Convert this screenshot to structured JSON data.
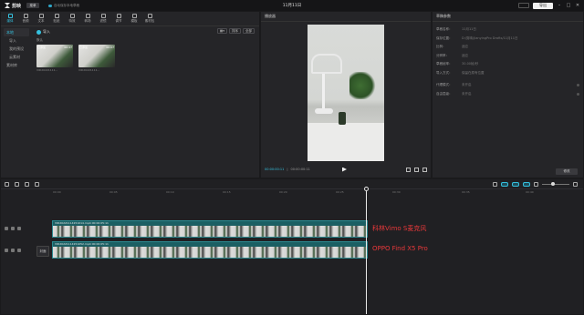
{
  "titlebar": {
    "app_name": "剪映",
    "menu_label": "菜单",
    "autosave_text": "自动保存本地草稿",
    "doc_title": "11月11日",
    "export_label": "导出"
  },
  "toolbar": {
    "items": [
      {
        "label": "媒体"
      },
      {
        "label": "音频"
      },
      {
        "label": "文本"
      },
      {
        "label": "贴纸"
      },
      {
        "label": "特效"
      },
      {
        "label": "转场"
      },
      {
        "label": "滤镜"
      },
      {
        "label": "调节"
      },
      {
        "label": "模板"
      },
      {
        "label": "素材包"
      }
    ]
  },
  "side_nav": {
    "items": [
      {
        "label": "本地"
      },
      {
        "label": "导入"
      },
      {
        "label": "我的预设"
      },
      {
        "label": "云素材"
      },
      {
        "label": "素材库"
      }
    ]
  },
  "media": {
    "import_label": "导入",
    "tools": [
      "排序",
      "全部"
    ],
    "section_label": "默认",
    "clips": [
      {
        "badge": "已添加",
        "duration": "00:47",
        "name": "VID20221111..."
      },
      {
        "badge": "已添加",
        "duration": "00:07",
        "name": "VID20221111..."
      }
    ]
  },
  "player": {
    "title": "播放器",
    "time_current": "00:00:00:11",
    "time_total": "00:00:00:11"
  },
  "properties": {
    "title": "草稿参数",
    "rows": [
      {
        "label": "草稿名称：",
        "value": "11月11日"
      },
      {
        "label": "保存位置：",
        "value": "D:/剪映/JianyingPro Drafts/11月11日"
      },
      {
        "label": "比例：",
        "value": "适应"
      },
      {
        "label": "分辨率：",
        "value": "适应"
      },
      {
        "label": "草稿帧率：",
        "value": "30.00帧/秒"
      },
      {
        "label": "导入方式：",
        "value": "保留在原有位置"
      }
    ],
    "rows2": [
      {
        "label": "代理模式：",
        "value": "未开启"
      },
      {
        "label": "自由层级：",
        "value": "未开启"
      }
    ],
    "edit_label": "修改"
  },
  "timeline": {
    "ticks": [
      "00:00",
      "00:05",
      "00:10",
      "00:15",
      "00:20",
      "00:25",
      "00:30",
      "00:35",
      "00:40"
    ],
    "cover_label": "封面",
    "tracks": [
      {
        "label": "VID20221114151014.mp4  00:00:05:11",
        "caption": "科林Vimo S麦克风"
      },
      {
        "label": "VID20221114151052.mp4  00:00:05:11",
        "caption": "OPPO Find X5 Pro"
      }
    ]
  },
  "colors": {
    "accent": "#35c2e0",
    "caption": "#e8383a",
    "clip": "#1b5f63"
  }
}
